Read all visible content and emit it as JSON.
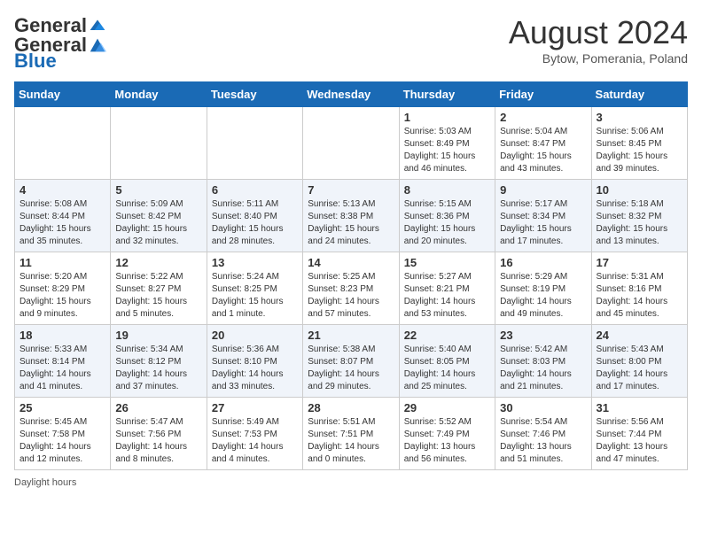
{
  "logo": {
    "general": "General",
    "blue": "Blue"
  },
  "title": "August 2024",
  "subtitle": "Bytow, Pomerania, Poland",
  "days_of_week": [
    "Sunday",
    "Monday",
    "Tuesday",
    "Wednesday",
    "Thursday",
    "Friday",
    "Saturday"
  ],
  "weeks": [
    [
      {
        "day": "",
        "info": ""
      },
      {
        "day": "",
        "info": ""
      },
      {
        "day": "",
        "info": ""
      },
      {
        "day": "",
        "info": ""
      },
      {
        "day": "1",
        "info": "Sunrise: 5:03 AM\nSunset: 8:49 PM\nDaylight: 15 hours and 46 minutes."
      },
      {
        "day": "2",
        "info": "Sunrise: 5:04 AM\nSunset: 8:47 PM\nDaylight: 15 hours and 43 minutes."
      },
      {
        "day": "3",
        "info": "Sunrise: 5:06 AM\nSunset: 8:45 PM\nDaylight: 15 hours and 39 minutes."
      }
    ],
    [
      {
        "day": "4",
        "info": "Sunrise: 5:08 AM\nSunset: 8:44 PM\nDaylight: 15 hours and 35 minutes."
      },
      {
        "day": "5",
        "info": "Sunrise: 5:09 AM\nSunset: 8:42 PM\nDaylight: 15 hours and 32 minutes."
      },
      {
        "day": "6",
        "info": "Sunrise: 5:11 AM\nSunset: 8:40 PM\nDaylight: 15 hours and 28 minutes."
      },
      {
        "day": "7",
        "info": "Sunrise: 5:13 AM\nSunset: 8:38 PM\nDaylight: 15 hours and 24 minutes."
      },
      {
        "day": "8",
        "info": "Sunrise: 5:15 AM\nSunset: 8:36 PM\nDaylight: 15 hours and 20 minutes."
      },
      {
        "day": "9",
        "info": "Sunrise: 5:17 AM\nSunset: 8:34 PM\nDaylight: 15 hours and 17 minutes."
      },
      {
        "day": "10",
        "info": "Sunrise: 5:18 AM\nSunset: 8:32 PM\nDaylight: 15 hours and 13 minutes."
      }
    ],
    [
      {
        "day": "11",
        "info": "Sunrise: 5:20 AM\nSunset: 8:29 PM\nDaylight: 15 hours and 9 minutes."
      },
      {
        "day": "12",
        "info": "Sunrise: 5:22 AM\nSunset: 8:27 PM\nDaylight: 15 hours and 5 minutes."
      },
      {
        "day": "13",
        "info": "Sunrise: 5:24 AM\nSunset: 8:25 PM\nDaylight: 15 hours and 1 minute."
      },
      {
        "day": "14",
        "info": "Sunrise: 5:25 AM\nSunset: 8:23 PM\nDaylight: 14 hours and 57 minutes."
      },
      {
        "day": "15",
        "info": "Sunrise: 5:27 AM\nSunset: 8:21 PM\nDaylight: 14 hours and 53 minutes."
      },
      {
        "day": "16",
        "info": "Sunrise: 5:29 AM\nSunset: 8:19 PM\nDaylight: 14 hours and 49 minutes."
      },
      {
        "day": "17",
        "info": "Sunrise: 5:31 AM\nSunset: 8:16 PM\nDaylight: 14 hours and 45 minutes."
      }
    ],
    [
      {
        "day": "18",
        "info": "Sunrise: 5:33 AM\nSunset: 8:14 PM\nDaylight: 14 hours and 41 minutes."
      },
      {
        "day": "19",
        "info": "Sunrise: 5:34 AM\nSunset: 8:12 PM\nDaylight: 14 hours and 37 minutes."
      },
      {
        "day": "20",
        "info": "Sunrise: 5:36 AM\nSunset: 8:10 PM\nDaylight: 14 hours and 33 minutes."
      },
      {
        "day": "21",
        "info": "Sunrise: 5:38 AM\nSunset: 8:07 PM\nDaylight: 14 hours and 29 minutes."
      },
      {
        "day": "22",
        "info": "Sunrise: 5:40 AM\nSunset: 8:05 PM\nDaylight: 14 hours and 25 minutes."
      },
      {
        "day": "23",
        "info": "Sunrise: 5:42 AM\nSunset: 8:03 PM\nDaylight: 14 hours and 21 minutes."
      },
      {
        "day": "24",
        "info": "Sunrise: 5:43 AM\nSunset: 8:00 PM\nDaylight: 14 hours and 17 minutes."
      }
    ],
    [
      {
        "day": "25",
        "info": "Sunrise: 5:45 AM\nSunset: 7:58 PM\nDaylight: 14 hours and 12 minutes."
      },
      {
        "day": "26",
        "info": "Sunrise: 5:47 AM\nSunset: 7:56 PM\nDaylight: 14 hours and 8 minutes."
      },
      {
        "day": "27",
        "info": "Sunrise: 5:49 AM\nSunset: 7:53 PM\nDaylight: 14 hours and 4 minutes."
      },
      {
        "day": "28",
        "info": "Sunrise: 5:51 AM\nSunset: 7:51 PM\nDaylight: 14 hours and 0 minutes."
      },
      {
        "day": "29",
        "info": "Sunrise: 5:52 AM\nSunset: 7:49 PM\nDaylight: 13 hours and 56 minutes."
      },
      {
        "day": "30",
        "info": "Sunrise: 5:54 AM\nSunset: 7:46 PM\nDaylight: 13 hours and 51 minutes."
      },
      {
        "day": "31",
        "info": "Sunrise: 5:56 AM\nSunset: 7:44 PM\nDaylight: 13 hours and 47 minutes."
      }
    ]
  ],
  "footer": "Daylight hours"
}
